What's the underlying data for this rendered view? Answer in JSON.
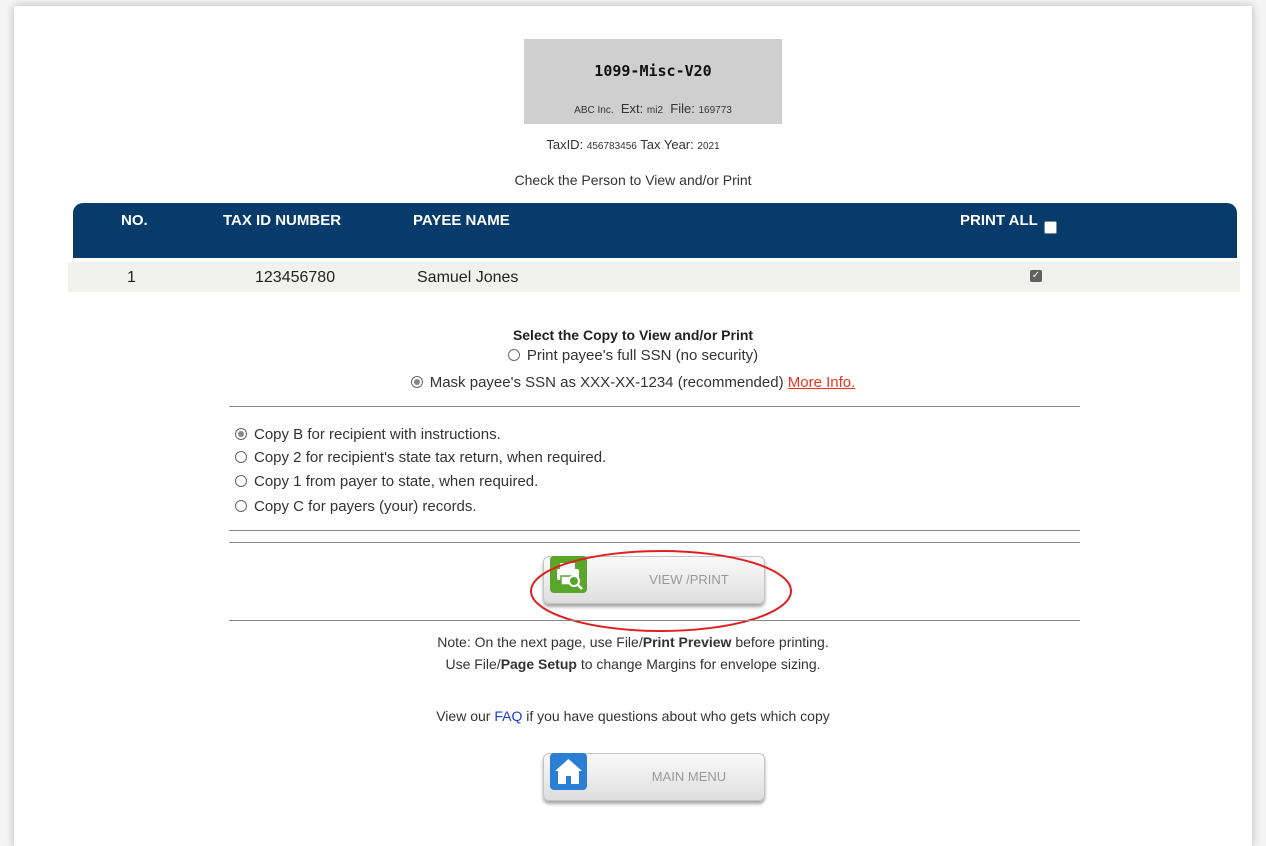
{
  "form": {
    "title": "1099-Misc-V20",
    "company": "ABC Inc.",
    "ext_label": "Ext:",
    "ext_value": "mi2",
    "file_label": "File:",
    "file_value": "169773",
    "taxid_label": "TaxID:",
    "taxid_value": "456783456",
    "taxyear_label": "Tax Year:",
    "taxyear_value": "2021"
  },
  "check_prompt": "Check the Person to View and/or Print",
  "table": {
    "headers": {
      "no": "NO.",
      "tin": "TAX ID NUMBER",
      "name": "PAYEE NAME",
      "print_all": "PRINT ALL"
    },
    "print_all_checked": false,
    "rows": [
      {
        "no": "1",
        "tin": "123456780",
        "name": "Samuel Jones",
        "checked": true
      }
    ]
  },
  "copy_select": {
    "title": "Select the Copy to View and/or Print",
    "ssn_full": "Print payee's full SSN (no security)",
    "ssn_mask": "Mask payee's SSN as XXX-XX-1234 (recommended)",
    "more_info": "More Info.",
    "ssn_selected": "mask",
    "copies": [
      "Copy B for recipient with instructions.",
      "Copy 2 for recipient's state tax return, when required.",
      "Copy 1 from payer to state, when required.",
      "Copy C for payers (your) records."
    ],
    "copy_selected": 0
  },
  "buttons": {
    "view_print": "VIEW /PRINT",
    "main_menu": "MAIN MENU"
  },
  "note": {
    "line1_pre": "Note: On the next page, use File/",
    "line1_bold": "Print Preview",
    "line1_post": " before printing.",
    "line2_pre": "Use File/",
    "line2_bold": "Page Setup",
    "line2_post": " to change Margins for envelope sizing."
  },
  "faq": {
    "pre": "View our ",
    "link": "FAQ",
    "post": " if you have questions about who gets which copy"
  },
  "colors": {
    "header_bg": "#063b6b",
    "highlight": "#e02020",
    "link_red": "#e33322",
    "link_blue": "#1a3fd0"
  }
}
